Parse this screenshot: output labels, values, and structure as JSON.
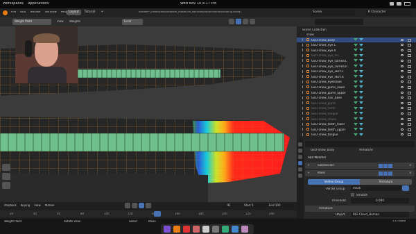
{
  "gnome_bar": {
    "activities": "Workspaces",
    "apps": "Applications",
    "clock": "Wed Nov 10  4:17 PM"
  },
  "menubar": {
    "items": [
      "File",
      "Edit",
      "Render",
      "Window",
      "Help"
    ],
    "tabs": [
      "Layout",
      "Tutorial",
      "+"
    ],
    "title": "Blender* [/media/dale/shepard_master/ce_workflow/file/animation/snow.rig.blend]",
    "scene_label": "Scene",
    "viewlayer_label": "R Character"
  },
  "viewport_header": {
    "mode": "Weight Paint",
    "orientation": "Local",
    "view": "View",
    "weights": "Weights"
  },
  "outliner": {
    "title": "Scene Collection",
    "root": "snow",
    "items": [
      {
        "name": "GEO-snow_body",
        "active": true,
        "dim": false
      },
      {
        "name": "GEO-snow_eye.L",
        "active": false,
        "dim": false
      },
      {
        "name": "GEO-snow_eye.R",
        "active": false,
        "dim": false
      },
      {
        "name": "GEO-snow_eye_iris",
        "active": false,
        "dim": true
      },
      {
        "name": "GEO-snow_eye_cornea.L",
        "active": false,
        "dim": false
      },
      {
        "name": "GEO-snow_eye_cornea.R",
        "active": false,
        "dim": false
      },
      {
        "name": "GEO-snow_eye_skirt.L",
        "active": false,
        "dim": false
      },
      {
        "name": "GEO-snow_eye_skirt.R",
        "active": false,
        "dim": false
      },
      {
        "name": "GEO-snow_eyebrows",
        "active": false,
        "dim": false
      },
      {
        "name": "GEO-snow_gums_lower",
        "active": false,
        "dim": false
      },
      {
        "name": "GEO-snow_gums_upper",
        "active": false,
        "dim": false
      },
      {
        "name": "GEO-snow_hair_base",
        "active": false,
        "dim": false
      },
      {
        "name": "GEO-snow_gums",
        "active": false,
        "dim": true
      },
      {
        "name": "GEO-snow_teeth",
        "active": false,
        "dim": true
      },
      {
        "name": "GEO-snow_tongue",
        "active": false,
        "dim": true
      },
      {
        "name": "GEO-snow_shoes",
        "active": false,
        "dim": true
      },
      {
        "name": "GEO-snow_teeth_lower",
        "active": false,
        "dim": false
      },
      {
        "name": "GEO-snow_teeth_upper",
        "active": false,
        "dim": false
      },
      {
        "name": "GEO-snow_tongue",
        "active": false,
        "dim": false
      }
    ]
  },
  "properties": {
    "object_name": "GEO-snow_body",
    "object_data": "Armature",
    "add_modifier": "Add Modifier",
    "modifiers": [
      {
        "name": "Subdivision"
      },
      {
        "name": "Mask"
      }
    ],
    "mode_tabs": [
      "Vertex Group",
      "Armature"
    ],
    "vertex_group_label": "Vertex Group",
    "vertex_group_value": "mask",
    "smooth_label": "Smooth",
    "threshold_label": "Threshold",
    "threshold_value": "0.000",
    "armature_mod": "Armature",
    "object_label": "Object",
    "object_value": "RIG-Cloud_Human"
  },
  "timeline": {
    "menu": [
      "Playback",
      "Keying",
      "View",
      "Marker"
    ],
    "current_frame": "92",
    "start_label": "Start",
    "start": "1",
    "end_label": "End",
    "end": "100",
    "ruler": [
      "20",
      "40",
      "60",
      "80",
      "100",
      "120",
      "140",
      "160",
      "180",
      "200",
      "220",
      "240"
    ]
  },
  "status": {
    "left": "Weight Paint",
    "mid": "Rotate View",
    "select": "Select",
    "move": "Move",
    "version": "3.1.0 alpha"
  },
  "colors": {
    "accent": "#4772b3",
    "mesh_wire": "#d8892e",
    "green_bone": "#6fc08c",
    "weight_red": "#ff1e1e"
  },
  "icons": [
    "weight-paint-mode-icon",
    "eye-icon",
    "camera-icon",
    "mesh-icon",
    "wrench-icon",
    "play-icon"
  ]
}
